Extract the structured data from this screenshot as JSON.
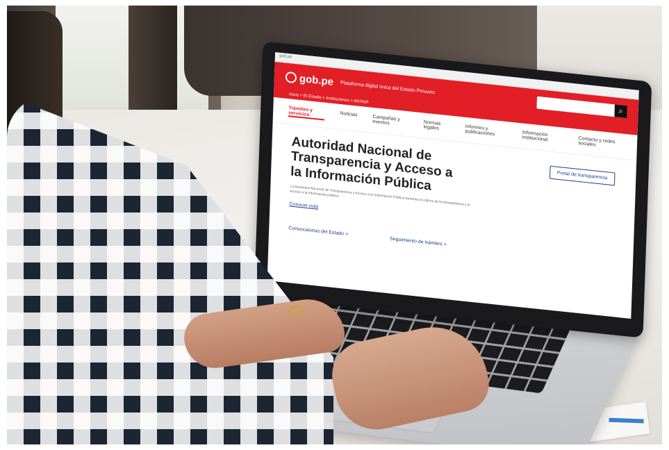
{
  "site": {
    "browser_bar": "gob.pe",
    "logo": "gob.pe",
    "tagline": "Plataforma digital única del Estado Peruano",
    "breadcrumb": "Inicio  >  El Estado  >  Instituciones  >  ANTAIP"
  },
  "nav": {
    "items": [
      "Trámites y servicios",
      "Noticias",
      "Campañas y eventos",
      "Normas legales",
      "Informes y publicaciones",
      "Información institucional",
      "Contacto y redes sociales"
    ]
  },
  "main": {
    "headline": "Autoridad Nacional de Transparencia y Acceso a la Información Pública",
    "description": "La Autoridad Nacional de Transparencia y Acceso a la Información Pública fomenta la cultura de la transparencia y el acceso a la información pública.",
    "more_link": "Conocer más",
    "portal_button": "Portal de transparencia"
  },
  "quick_links": {
    "convocatorias": "Convocatorias del Estado  >",
    "seguimiento": "Seguimiento de trámites  >"
  },
  "colors": {
    "brand_red": "#e21f26",
    "link_blue": "#1f3c8c"
  }
}
